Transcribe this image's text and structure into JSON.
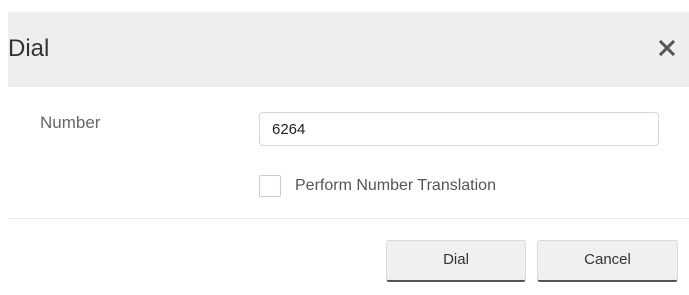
{
  "dialog": {
    "title": "Dial",
    "close_icon": "close-icon"
  },
  "form": {
    "number_label": "Number",
    "number_value": "6264",
    "translation_label": "Perform Number Translation",
    "translation_checked": false
  },
  "footer": {
    "dial_label": "Dial",
    "cancel_label": "Cancel"
  },
  "colors": {
    "header_bg": "#edeef0",
    "button_bg": "#eff0f1",
    "button_bottom_border": "#555555"
  }
}
